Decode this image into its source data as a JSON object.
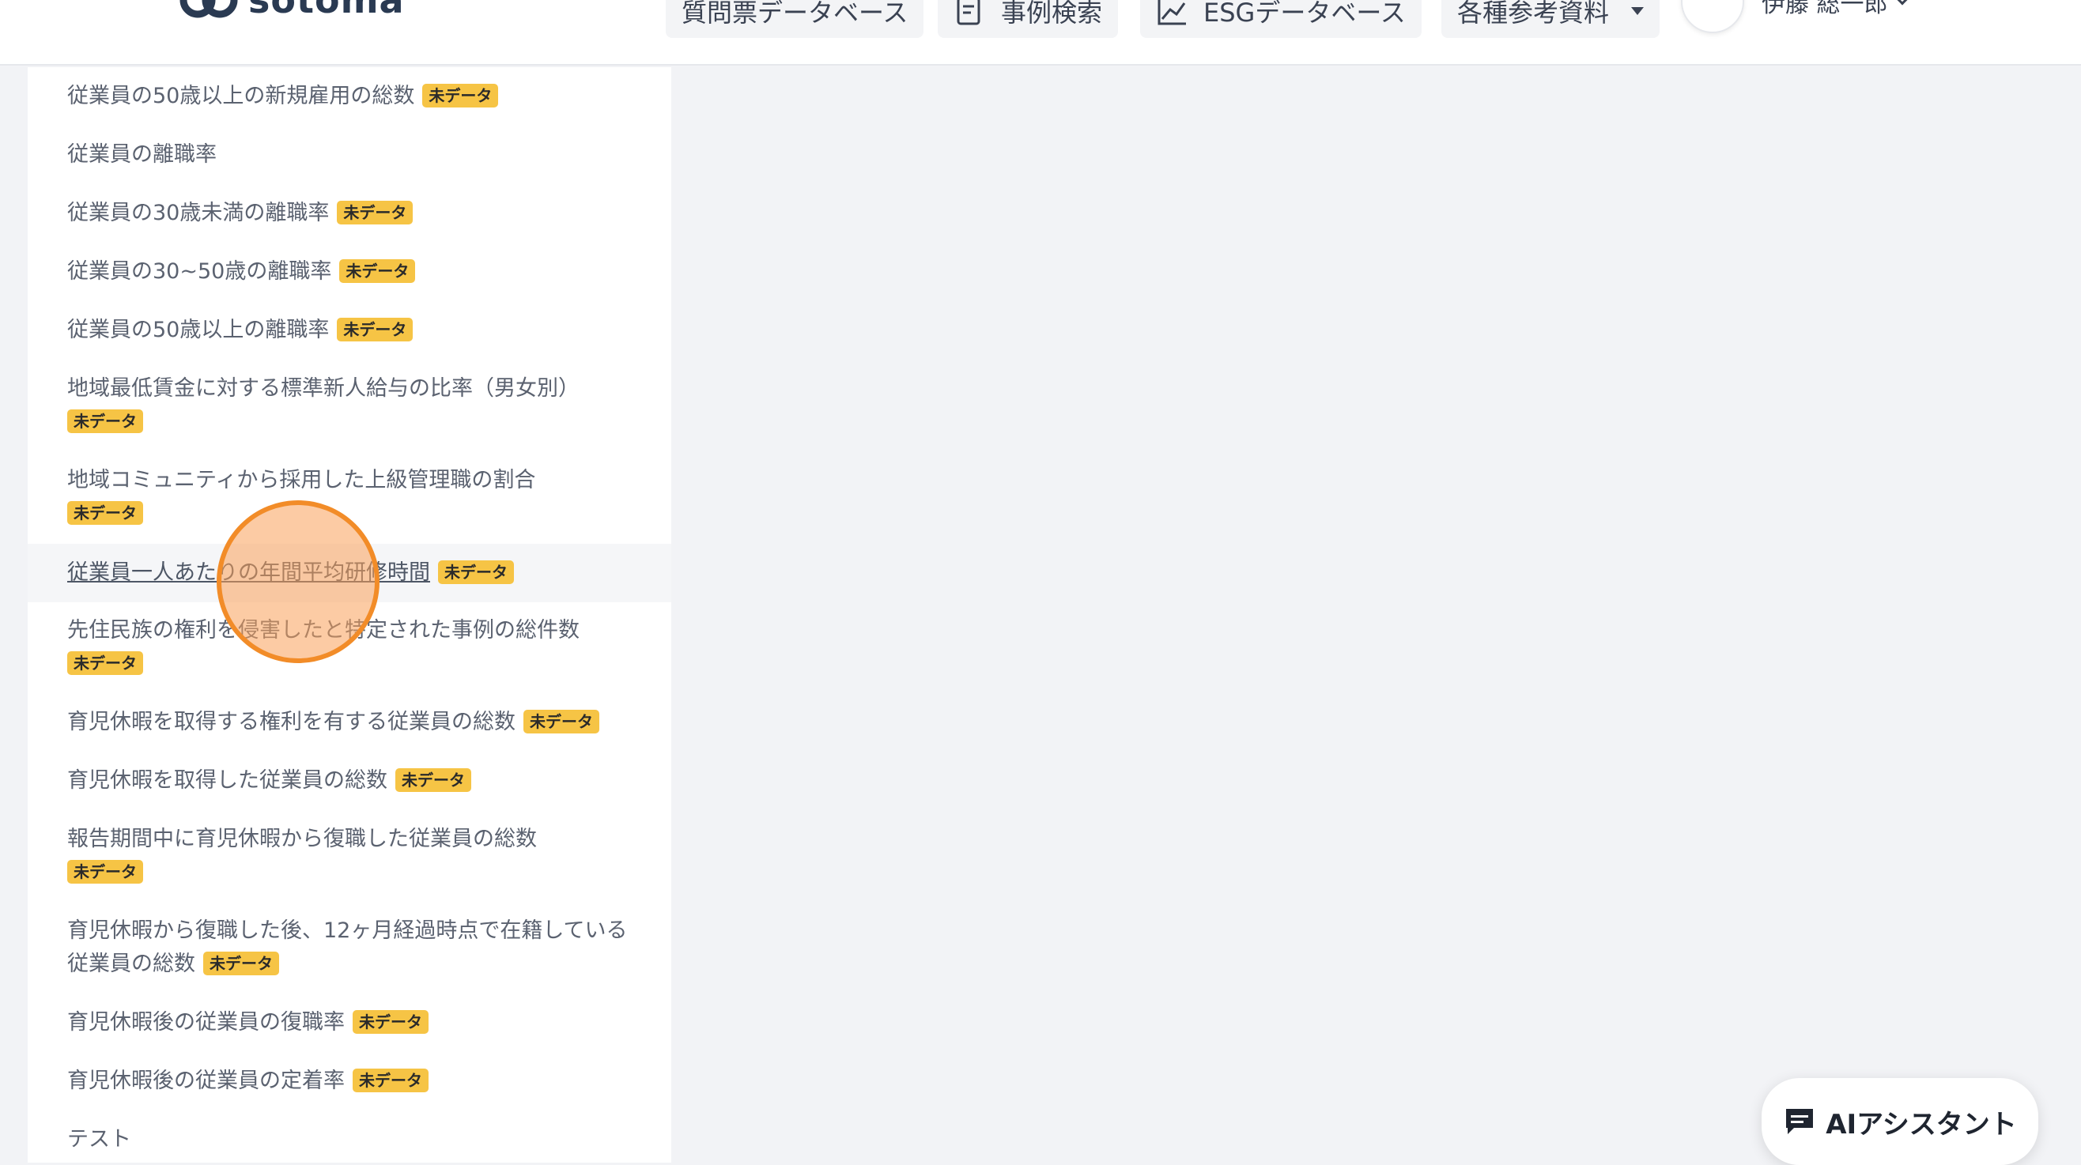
{
  "header": {
    "logo_text": "sotoma",
    "logo_mark": "®",
    "nav": [
      {
        "label": "質問票データベース",
        "icon": "database-icon"
      },
      {
        "label": "事例検索",
        "icon": "document-search-icon"
      },
      {
        "label": "ESGデータベース",
        "icon": "chart-line-icon"
      },
      {
        "label": "各種参考資料",
        "icon": "caret-down-icon"
      }
    ],
    "user_name": "伊藤 総一郎"
  },
  "sidebar": {
    "items": [
      {
        "label": "従業員の50歳以上の新規雇用の総数",
        "badge": "未データ"
      },
      {
        "label": "従業員の離職率",
        "badge": ""
      },
      {
        "label": "従業員の30歳未満の離職率",
        "badge": "未データ"
      },
      {
        "label": "従業員の30~50歳の離職率",
        "badge": "未データ"
      },
      {
        "label": "従業員の50歳以上の離職率",
        "badge": "未データ"
      },
      {
        "label": "地域最低賃金に対する標準新人給与の比率（男女別）",
        "badge": "未データ"
      },
      {
        "label": "地域コミュニティから採用した上級管理職の割合",
        "badge": "未データ"
      },
      {
        "label": "従業員一人あたりの年間平均研修時間",
        "badge": "未データ"
      },
      {
        "label": "先住民族の権利を侵害したと特定された事例の総件数",
        "badge": "未データ"
      },
      {
        "label": "育児休暇を取得する権利を有する従業員の総数",
        "badge": "未データ"
      },
      {
        "label": "育児休暇を取得した従業員の総数",
        "badge": "未データ"
      },
      {
        "label": "報告期間中に育児休暇から復職した従業員の総数",
        "badge": "未データ"
      },
      {
        "label": "育児休暇から復職した後、12ヶ月経過時点で在籍している従業員の総数",
        "badge": "未データ"
      },
      {
        "label": "育児休暇後の従業員の復職率",
        "badge": "未データ"
      },
      {
        "label": "育児休暇後の従業員の定着率",
        "badge": "未データ"
      },
      {
        "label": "テスト",
        "badge": ""
      }
    ]
  },
  "ai_assistant": {
    "label": "AIアシスタント",
    "icon": "chat-icon"
  }
}
